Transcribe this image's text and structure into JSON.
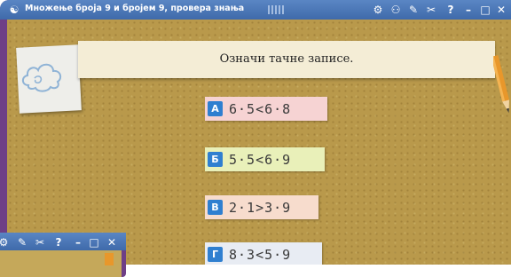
{
  "window": {
    "title": "Множење броја 9 и бројем 9, провера знања",
    "controls": [
      "⚙",
      "⚇",
      "✎",
      "✂",
      "?",
      "–",
      "□",
      "✕"
    ]
  },
  "banner": {
    "question": "Означи тачне записе."
  },
  "answers": [
    {
      "letter": "А",
      "expr": "6·5<6·8",
      "color": "#f6d3d3"
    },
    {
      "letter": "Б",
      "expr": "5·5<6·9",
      "color": "#e9f0b9"
    },
    {
      "letter": "В",
      "expr": "2·1>3·9",
      "color": "#f7dccd"
    },
    {
      "letter": "Г",
      "expr": "8·3<5·9",
      "color": "#e8ecf3"
    }
  ],
  "window2": {
    "controls": [
      "⚙",
      "✎",
      "✂",
      "?",
      "–",
      "□",
      "✕"
    ]
  }
}
